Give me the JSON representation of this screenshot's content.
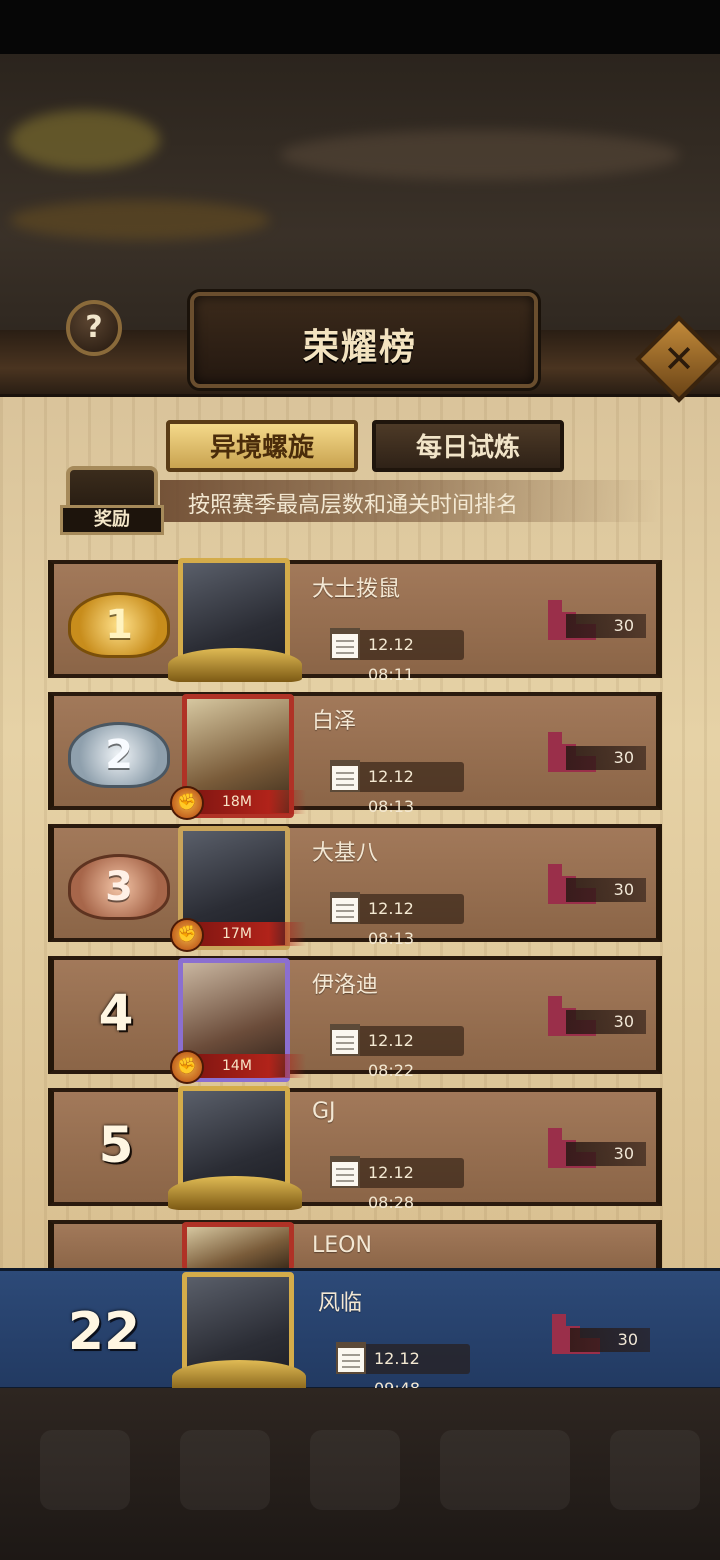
{
  "window": {
    "title": "荣耀榜"
  },
  "tabs": [
    {
      "label": "异境螺旋",
      "active": true
    },
    {
      "label": "每日试炼",
      "active": false
    }
  ],
  "reward": {
    "label": "奖励"
  },
  "info": "按照赛季最高层数和通关时间排名",
  "rows": [
    {
      "rank": "1",
      "medal": "gold",
      "name": "大土拨鼠",
      "time": "12.12 08:11",
      "floor": "30",
      "power": ""
    },
    {
      "rank": "2",
      "medal": "silver",
      "name": "白泽",
      "time": "12.12 08:13",
      "floor": "30",
      "power": "18M"
    },
    {
      "rank": "3",
      "medal": "bronze",
      "name": "大基八",
      "time": "12.12 08:13",
      "floor": "30",
      "power": "17M"
    },
    {
      "rank": "4",
      "medal": "",
      "name": "伊洛迪",
      "time": "12.12 08:22",
      "floor": "30",
      "power": "14M"
    },
    {
      "rank": "5",
      "medal": "",
      "name": "GJ",
      "time": "12.12 08:28",
      "floor": "30",
      "power": ""
    },
    {
      "rank": "",
      "medal": "",
      "name": "LEON",
      "time": "",
      "floor": "",
      "power": ""
    }
  ],
  "self": {
    "rank": "22",
    "name": "风临",
    "time": "12.12 09:48",
    "floor": "30"
  },
  "icons": {
    "help": "question-mark-icon",
    "close": "close-icon",
    "calendar": "calendar-icon",
    "floor": "stairs-icon",
    "power": "fist-icon"
  },
  "colors": {
    "accent_gold": "#d4ac4a",
    "self_row": "#2d4a78",
    "panel": "#e6d2a6"
  }
}
